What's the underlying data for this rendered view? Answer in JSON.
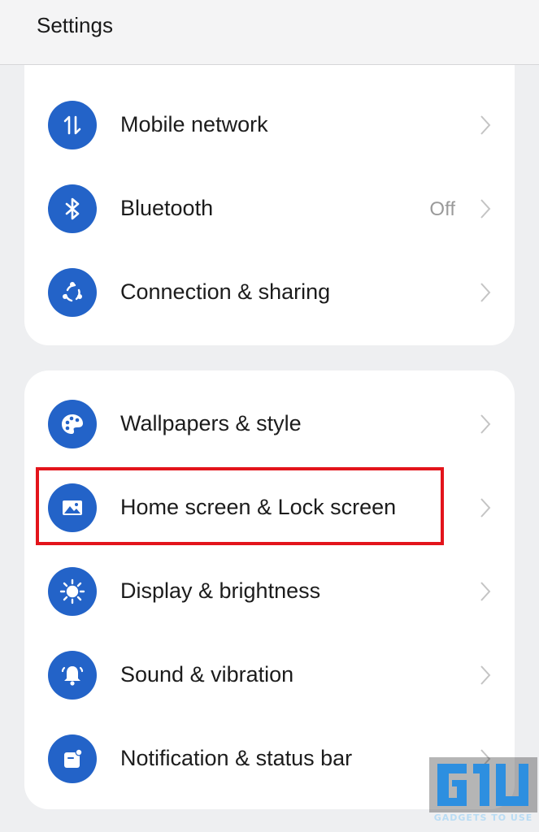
{
  "header": {
    "title": "Settings"
  },
  "groups": [
    {
      "items": [
        {
          "label": "Mobile network",
          "icon": "mobile-data-arrows-icon"
        },
        {
          "label": "Bluetooth",
          "value": "Off",
          "icon": "bluetooth-icon"
        },
        {
          "label": "Connection & sharing",
          "icon": "share-nodes-icon"
        }
      ]
    },
    {
      "items": [
        {
          "label": "Wallpapers & style",
          "icon": "palette-icon"
        },
        {
          "label": "Home screen & Lock screen",
          "icon": "picture-icon"
        },
        {
          "label": "Display & brightness",
          "icon": "sun-icon"
        },
        {
          "label": "Sound & vibration",
          "icon": "bell-icon"
        },
        {
          "label": "Notification & status bar",
          "icon": "notification-icon"
        }
      ]
    }
  ],
  "colors": {
    "accent": "#2363c8",
    "highlight": "#e3141b",
    "background": "#eeeff1"
  },
  "watermark": {
    "caption": "GADGETS TO USE"
  }
}
